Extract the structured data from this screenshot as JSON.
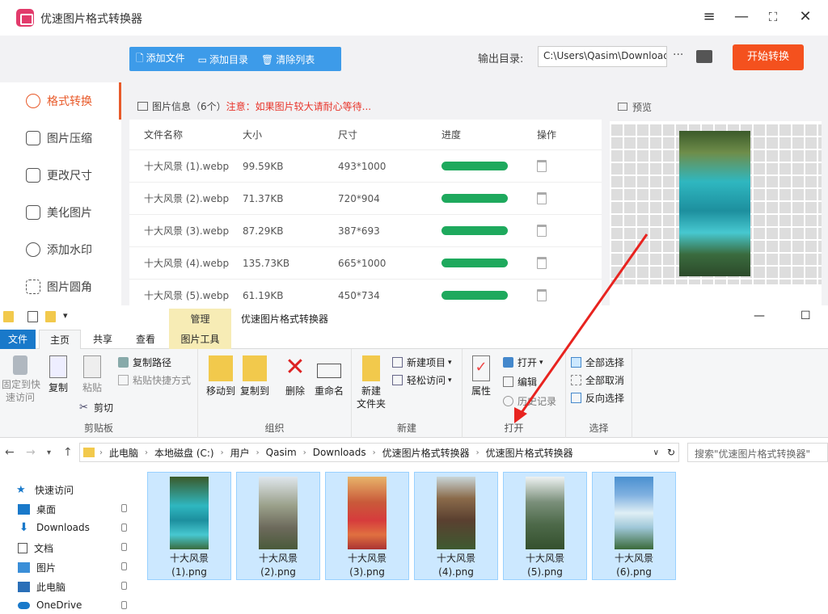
{
  "app": {
    "title": "优速图片格式转换器",
    "toolbar": {
      "add_file": "添加文件",
      "add_dir": "添加目录",
      "clear_list": "清除列表",
      "output_label": "输出目录:",
      "output_path": "C:\\Users\\Qasim\\Downloads",
      "more": "···",
      "start": "开始转换"
    },
    "sidebar": [
      {
        "label": "格式转换",
        "active": true
      },
      {
        "label": "图片压缩"
      },
      {
        "label": "更改尺寸"
      },
      {
        "label": "美化图片"
      },
      {
        "label": "添加水印"
      },
      {
        "label": "图片圆角"
      }
    ],
    "info": {
      "title": "图片信息（6个）",
      "warning": "注意：如果图片较大请耐心等待..."
    },
    "columns": [
      "文件名称",
      "大小",
      "尺寸",
      "进度",
      "操作"
    ],
    "rows": [
      {
        "name": "十大风景 (1).webp",
        "size": "99.59KB",
        "dim": "493*1000",
        "progress": 1.0
      },
      {
        "name": "十大风景 (2).webp",
        "size": "71.37KB",
        "dim": "720*904",
        "progress": 1.0
      },
      {
        "name": "十大风景 (3).webp",
        "size": "87.29KB",
        "dim": "387*693",
        "progress": 1.0
      },
      {
        "name": "十大风景 (4).webp",
        "size": "135.73KB",
        "dim": "665*1000",
        "progress": 1.0
      },
      {
        "name": "十大风景 (5).webp",
        "size": "61.19KB",
        "dim": "450*734",
        "progress": 1.0
      }
    ],
    "preview_label": "预览"
  },
  "explorer": {
    "manage": "管理",
    "title": "优速图片格式转换器",
    "tabs": {
      "file": "文件",
      "home": "主页",
      "share": "共享",
      "view": "查看",
      "pictools": "图片工具"
    },
    "ribbon": {
      "pin": "固定到快\n速访问",
      "copy": "复制",
      "paste": "粘贴",
      "copy_path": "复制路径",
      "paste_shortcut": "粘贴快捷方式",
      "cut": "剪切",
      "clipboard": "剪贴板",
      "move_to": "移动到",
      "copy_to": "复制到",
      "delete": "删除",
      "rename": "重命名",
      "organize": "组织",
      "new_folder": "新建\n文件夹",
      "new_item": "新建项目",
      "easy_access": "轻松访问",
      "new": "新建",
      "properties": "属性",
      "open": "打开",
      "edit": "编辑",
      "history": "历史记录",
      "open_group": "打开",
      "select_all": "全部选择",
      "select_none": "全部取消",
      "invert": "反向选择",
      "select": "选择"
    },
    "path": [
      "此电脑",
      "本地磁盘 (C:)",
      "用户",
      "Qasim",
      "Downloads",
      "优速图片格式转换器",
      "优速图片格式转换器"
    ],
    "search_placeholder": "搜索\"优速图片格式转换器\"",
    "nav": [
      {
        "label": "快速访问"
      },
      {
        "label": "桌面",
        "pinned": true
      },
      {
        "label": "Downloads",
        "pinned": true
      },
      {
        "label": "文档",
        "pinned": true
      },
      {
        "label": "图片",
        "pinned": true
      },
      {
        "label": "此电脑",
        "pinned": true
      },
      {
        "label": "OneDrive",
        "pinned": true
      }
    ],
    "files": [
      {
        "line1": "十大风景",
        "line2": "(1).png"
      },
      {
        "line1": "十大风景",
        "line2": "(2).png"
      },
      {
        "line1": "十大风景",
        "line2": "(3).png"
      },
      {
        "line1": "十大风景",
        "line2": "(4).png"
      },
      {
        "line1": "十大风景",
        "line2": "(5).png"
      },
      {
        "line1": "十大风景",
        "line2": "(6).png"
      }
    ]
  },
  "colors": {
    "accent": "#f4511e",
    "blue": "#3d9be9",
    "progress": "#1ea95d",
    "selection": "#cce8ff"
  }
}
